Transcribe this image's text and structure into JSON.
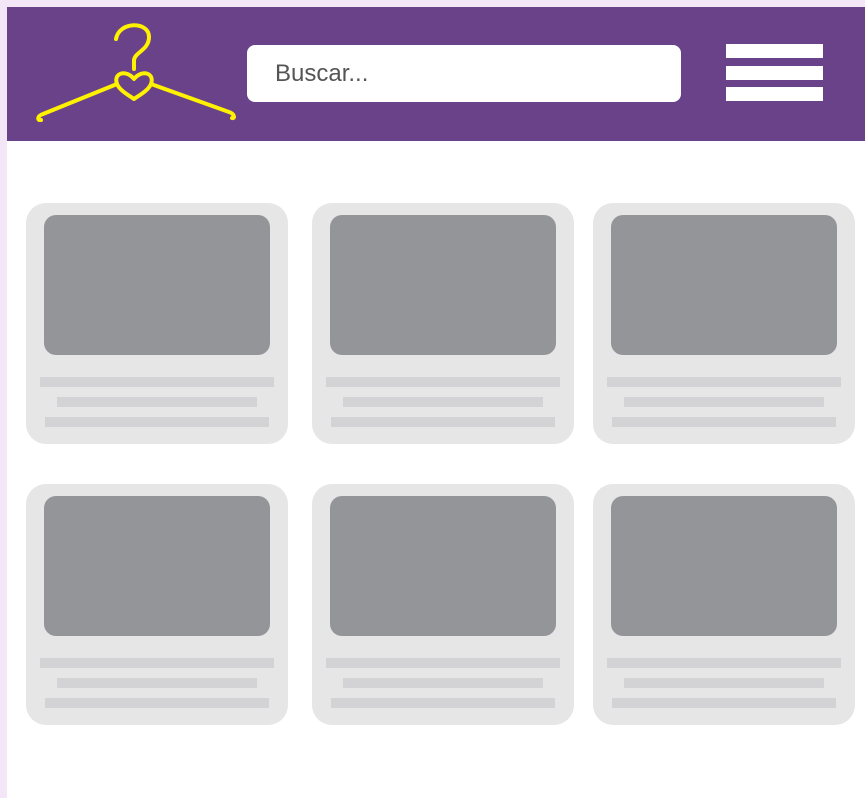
{
  "header": {
    "logo_icon": "hanger-heart-icon",
    "search": {
      "placeholder": "Buscar...",
      "value": ""
    },
    "menu_icon": "hamburger-menu-icon"
  },
  "colors": {
    "header_bg": "#6a4289",
    "logo": "#fff200",
    "card_bg": "#e6e6e7",
    "thumb_bg": "#949598",
    "line": "#d3d3d5",
    "page_edge": "#f3e6f6"
  },
  "products": {
    "count": 6
  }
}
